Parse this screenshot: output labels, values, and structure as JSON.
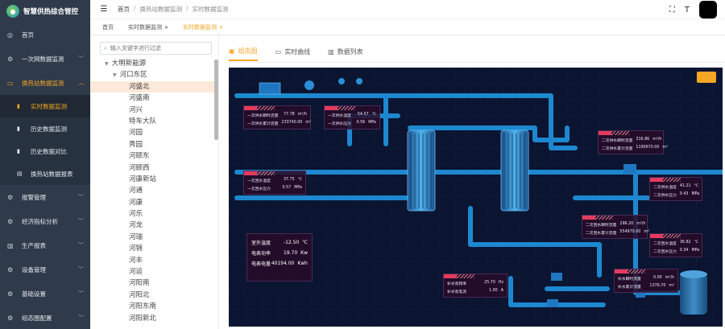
{
  "app": {
    "title": "智慧供热综合管控",
    "logo_icon": "leaf-drop-logo"
  },
  "sidebar": {
    "items": [
      {
        "label": "首页",
        "icon": "dashboard-icon",
        "has_arrow": false
      },
      {
        "label": "一次网数据监测",
        "icon": "gear-icon",
        "has_arrow": true
      },
      {
        "label": "换热站数据监测",
        "icon": "monitor-icon",
        "has_arrow": true,
        "active": true,
        "children": [
          {
            "label": "实时数据监测",
            "icon": "bar-chart-icon",
            "active": true
          },
          {
            "label": "历史数据监测",
            "icon": "bar-chart-icon"
          },
          {
            "label": "历史数据对比",
            "icon": "bar-chart-icon"
          },
          {
            "label": "换热站数据报表",
            "icon": "table-icon"
          }
        ]
      },
      {
        "label": "报警管理",
        "icon": "gear-icon",
        "has_arrow": true
      },
      {
        "label": "经济指标分析",
        "icon": "gear-icon",
        "has_arrow": true
      },
      {
        "label": "生产报表",
        "icon": "chart-icon",
        "has_arrow": true
      },
      {
        "label": "设备管理",
        "icon": "gear-icon",
        "has_arrow": true
      },
      {
        "label": "基础设置",
        "icon": "gear-icon",
        "has_arrow": true
      },
      {
        "label": "组态图配置",
        "icon": "gear-icon",
        "has_arrow": true
      }
    ]
  },
  "header": {
    "breadcrumb": [
      "首页",
      "换热站数据监测",
      "实时数据监测"
    ],
    "icons": [
      "fullscreen-icon",
      "font-size-icon"
    ]
  },
  "tagbar": {
    "tags": [
      {
        "label": "首页",
        "active": false,
        "closable": false
      },
      {
        "label": "实时数据监测",
        "active": false,
        "closable": true
      },
      {
        "label": "实时数据监测",
        "active": true,
        "closable": true
      }
    ]
  },
  "tree": {
    "search_placeholder": "输入关键字进行过滤",
    "root": "大明新能源",
    "group": "河口东区",
    "nodes": [
      "河盛北",
      "河盛南",
      "河兴",
      "特车大队",
      "河园",
      "秀园",
      "河颐东",
      "河颐西",
      "河康新站",
      "河通",
      "河康",
      "河乐",
      "河龙",
      "河瑞",
      "河锦",
      "河丰",
      "河运",
      "河阳南",
      "河阳北",
      "河阳东南",
      "河阳新北"
    ],
    "selected_index": 0
  },
  "tabs": [
    {
      "label": "组态图",
      "icon": "image-icon",
      "active": true
    },
    {
      "label": "实时曲线",
      "icon": "monitor-icon",
      "active": false
    },
    {
      "label": "数据列表",
      "icon": "bar-chart-icon",
      "active": false
    }
  ],
  "diagram": {
    "colors": {
      "background": "#0b1430",
      "pipe": "#1f8fd8",
      "panel_accent": "#e33b5e",
      "button": "#f5a623"
    },
    "panels": [
      {
        "id": "p1",
        "rows": [
          {
            "label": "一次供水瞬时流量",
            "value": "77.78",
            "unit": "m³/h"
          },
          {
            "label": "一次供水累计流量",
            "value": "233740.00",
            "unit": "m³"
          }
        ]
      },
      {
        "id": "p2",
        "rows": [
          {
            "label": "一次供水温度",
            "value": "54.57",
            "unit": "℃"
          },
          {
            "label": "一次供水压力",
            "value": "0.56",
            "unit": "MPa"
          }
        ]
      },
      {
        "id": "p3",
        "rows": [
          {
            "label": "二次供水瞬时流量",
            "value": "316.86",
            "unit": "m³/h"
          },
          {
            "label": "二次供水累计流量",
            "value": "1190670.00",
            "unit": "m³"
          }
        ]
      },
      {
        "id": "p4",
        "rows": [
          {
            "label": "一次回水温度",
            "value": "37.75",
            "unit": "℃"
          },
          {
            "label": "一次回水压力",
            "value": "0.57",
            "unit": "MPa"
          }
        ]
      },
      {
        "id": "p5",
        "rows": [
          {
            "label": "二次供水温度",
            "value": "41.21",
            "unit": "℃"
          },
          {
            "label": "二次供水压力",
            "value": "0.43",
            "unit": "MPa"
          }
        ]
      },
      {
        "id": "p6",
        "rows": [
          {
            "label": "二次回水瞬时流量",
            "value": "296.20",
            "unit": "m³/h"
          },
          {
            "label": "二次回水累计流量",
            "value": "554970.00",
            "unit": "m³"
          }
        ]
      },
      {
        "id": "p7",
        "rows": [
          {
            "label": "二次回水温度",
            "value": "36.82",
            "unit": "℃"
          },
          {
            "label": "二次回水压力",
            "value": "0.34",
            "unit": "MPa"
          }
        ]
      },
      {
        "id": "p8",
        "rows": [
          {
            "label": "补水泵频率",
            "value": "25.70",
            "unit": "Hz"
          },
          {
            "label": "补水泵电流",
            "value": "1.00",
            "unit": "A"
          }
        ]
      },
      {
        "id": "p9",
        "rows": [
          {
            "label": "补水瞬时流量",
            "value": "0.00",
            "unit": "m³/h"
          },
          {
            "label": "补水累计流量",
            "value": "1376.70",
            "unit": "m³"
          }
        ]
      }
    ],
    "env": [
      {
        "label": "室外温度",
        "value": "-12.50",
        "unit": "℃"
      },
      {
        "label": "电表功率",
        "value": "19.70",
        "unit": "Kw"
      },
      {
        "label": "电表电量",
        "value": "40194.00",
        "unit": "Kwh"
      }
    ]
  }
}
